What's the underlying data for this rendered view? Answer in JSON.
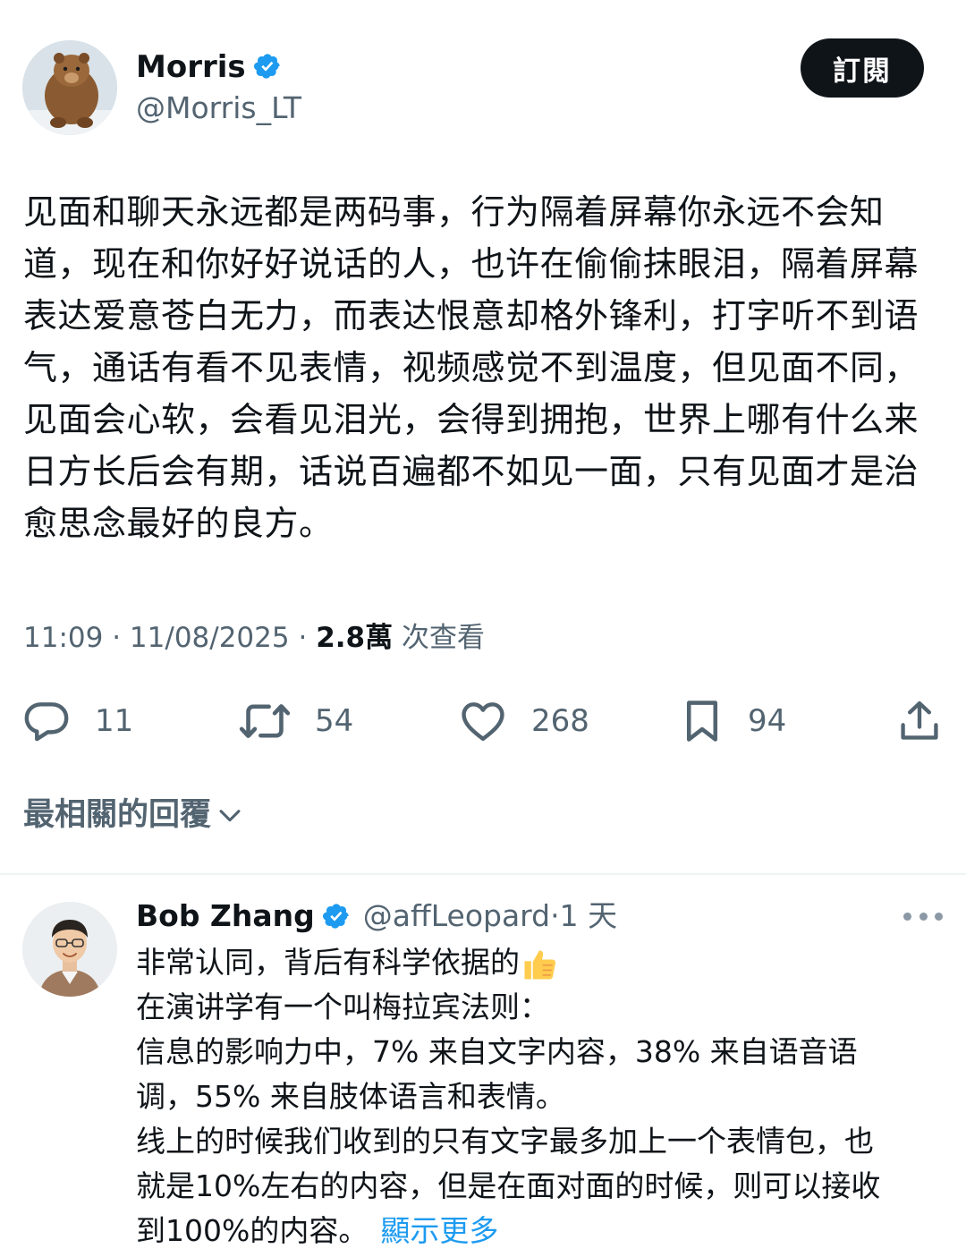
{
  "post": {
    "author_name": "Morris",
    "author_handle": "@Morris_LT",
    "subscribe_label": "訂閱",
    "text": "见面和聊天永远都是两码事，行为隔着屏幕你永远不会知道，现在和你好好说话的人，也许在偷偷抹眼泪，隔着屏幕表达爱意苍白无力，而表达恨意却格外锋利，打字听不到语气，通话有看不见表情，视频感觉不到温度，但见面不同，见面会心软，会看见泪光，会得到拥抱，世界上哪有什么来日方长后会有期，话说百遍都不如见一面，只有见面才是治愈思念最好的良方。",
    "time": "11:09",
    "date": "11/08/2025",
    "views": "2.8萬",
    "views_label": "次查看",
    "actions": {
      "replies": "11",
      "reposts": "54",
      "likes": "268",
      "bookmarks": "94"
    }
  },
  "replies_section": {
    "title": "最相關的回覆"
  },
  "reply": {
    "author_name": "Bob Zhang",
    "author_handle": "@affLeopard",
    "time_ago": "1 天",
    "lines": [
      "非常认同，背后有科学依据的",
      "在演讲学有一个叫梅拉宾法则：",
      "信息的影响力中，7% 来自文字内容，38% 来自语音语",
      "调，55% 来自肢体语言和表情。",
      "线上的时候我们收到的只有文字最多加上一个表情包，也",
      "就是10%左右的内容，但是在面对面的时候，则可以接收",
      "到100%的内容。"
    ],
    "show_more": "顯示更多"
  },
  "colors": {
    "text": "#0f1419",
    "secondary": "#536471",
    "accent": "#1d9bf0",
    "button_bg": "#0f1419"
  },
  "icons": [
    "verified-badge-icon",
    "reply-icon",
    "repost-icon",
    "like-icon",
    "bookmark-icon",
    "share-icon",
    "chevron-down-icon",
    "more-icon",
    "thumbs-up-emoji"
  ]
}
